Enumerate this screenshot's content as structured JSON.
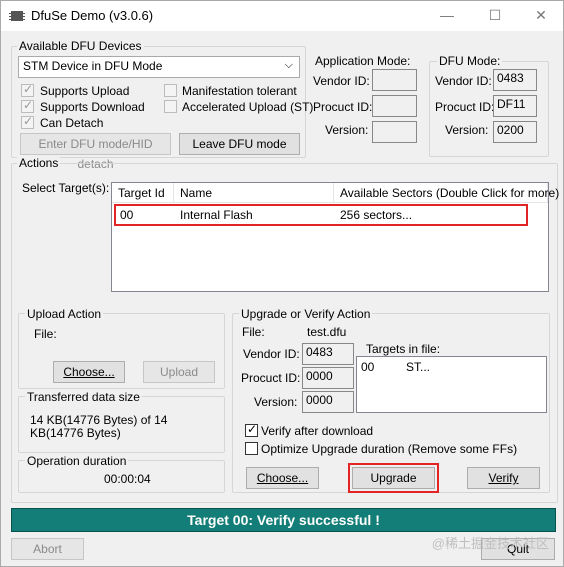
{
  "window": {
    "title": "DfuSe Demo (v3.0.6)",
    "minimize": "—",
    "maximize": "☐",
    "close": "✕"
  },
  "devices": {
    "label": "Available DFU Devices",
    "selected": "STM Device in DFU Mode",
    "options": [
      "Supports Upload",
      "Supports Download",
      "Can Detach",
      "Manifestation tolerant",
      "Accelerated Upload (ST)"
    ],
    "enter_dfu": "Enter DFU mode/HID detach",
    "leave_dfu": "Leave DFU mode"
  },
  "app_mode": {
    "label": "Application Mode:",
    "vendor": "Vendor ID:",
    "product": "Procuct ID:",
    "version": "Version:",
    "vendor_val": "",
    "product_val": "",
    "version_val": ""
  },
  "dfu_mode": {
    "label": "DFU Mode:",
    "vendor": "Vendor ID:",
    "product": "Procuct ID:",
    "version": "Version:",
    "vendor_val": "0483",
    "product_val": "DF11",
    "version_val": "0200"
  },
  "actions": {
    "label": "Actions",
    "select_targets": "Select Target(s):",
    "columns": [
      "Target Id",
      "Name",
      "Available Sectors (Double Click for more)"
    ],
    "rows": [
      {
        "id": "00",
        "name": "Internal Flash",
        "sectors": "256 sectors..."
      }
    ]
  },
  "upload": {
    "label": "Upload Action",
    "file": "File:",
    "choose": "Choose...",
    "upload": "Upload"
  },
  "transfer": {
    "label": "Transferred data size",
    "text": "14 KB(14776 Bytes) of 14 KB(14776 Bytes)"
  },
  "duration": {
    "label": "Operation duration",
    "value": "00:00:04"
  },
  "upgrade": {
    "label": "Upgrade or Verify Action",
    "file": "File:",
    "file_val": "test.dfu",
    "vendor": "Vendor ID:",
    "vendor_val": "0483",
    "product": "Procuct ID:",
    "product_val": "0000",
    "version": "Version:",
    "version_val": "0000",
    "targets_label": "Targets in file:",
    "targets": [
      {
        "id": "00",
        "name": "ST..."
      }
    ],
    "verify_after": "Verify after download",
    "optimize": "Optimize Upgrade duration (Remove some FFs)",
    "choose": "Choose...",
    "upgrade": "Upgrade",
    "verify": "Verify"
  },
  "status": "Target 00: Verify successful !",
  "abort": "Abort",
  "quit": "Quit",
  "watermark": "@稀土掘金技术社区"
}
